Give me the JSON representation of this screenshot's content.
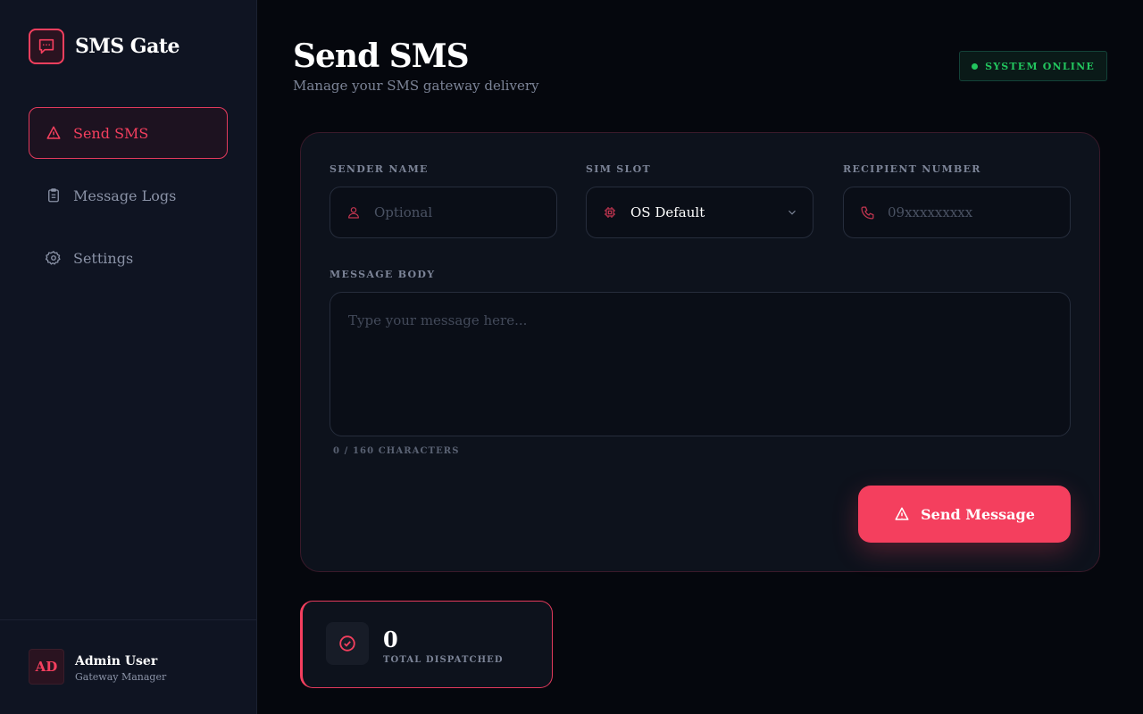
{
  "app": {
    "name": "SMS Gate"
  },
  "colors": {
    "accent": "#f43f5e",
    "success": "#22c55e",
    "background": "#05070d",
    "sidebar": "#0f1422"
  },
  "sidebar": {
    "items": [
      {
        "label": "Send SMS",
        "icon": "send-icon",
        "active": true
      },
      {
        "label": "Message Logs",
        "icon": "clipboard-icon",
        "active": false
      },
      {
        "label": "Settings",
        "icon": "gear-icon",
        "active": false
      }
    ],
    "user": {
      "initials": "AD",
      "name": "Admin User",
      "role": "Gateway Manager"
    }
  },
  "header": {
    "title": "Send SMS",
    "subtitle": "Manage your SMS gateway delivery",
    "status": "SYSTEM ONLINE"
  },
  "form": {
    "sender": {
      "label": "SENDER NAME",
      "placeholder": "Optional",
      "icon": "user-icon"
    },
    "sim": {
      "label": "SIM SLOT",
      "value": "OS Default",
      "icon": "chip-icon"
    },
    "recipient": {
      "label": "RECIPIENT NUMBER",
      "placeholder": "09xxxxxxxxx",
      "icon": "phone-icon"
    },
    "message": {
      "label": "MESSAGE BODY",
      "placeholder": "Type your message here...",
      "char_count": "0 / 160 CHARACTERS"
    },
    "submit_label": "Send Message"
  },
  "stats": {
    "total_dispatched": {
      "value": "0",
      "label": "TOTAL DISPATCHED",
      "icon": "check-circle-icon"
    }
  }
}
